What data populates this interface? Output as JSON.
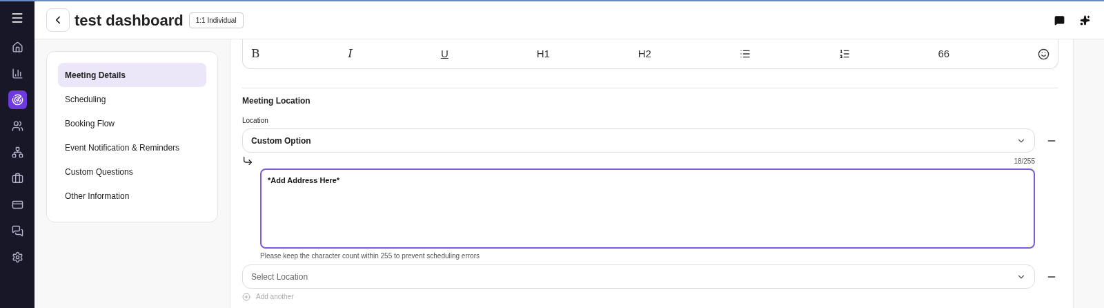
{
  "nav": [
    {
      "selected": false
    },
    {
      "selected": false
    },
    {
      "selected": true
    },
    {
      "selected": false
    },
    {
      "selected": false
    },
    {
      "selected": false
    },
    {
      "selected": false
    },
    {
      "selected": false
    },
    {
      "selected": false
    }
  ],
  "header": {
    "title": "test dashboard",
    "badge": "1:1 Individual"
  },
  "sections": [
    {
      "label": "Meeting Details",
      "selected": true
    },
    {
      "label": "Scheduling",
      "selected": false
    },
    {
      "label": "Booking Flow",
      "selected": false
    },
    {
      "label": "Event Notification & Reminders",
      "selected": false
    },
    {
      "label": "Custom Questions",
      "selected": false
    },
    {
      "label": "Other Information",
      "selected": false
    }
  ],
  "toolbar": [
    {
      "kind": "bold",
      "label": "B"
    },
    {
      "kind": "italic",
      "label": "I"
    },
    {
      "kind": "underline",
      "label": "U"
    },
    {
      "kind": "text",
      "label": "H1"
    },
    {
      "kind": "text",
      "label": "H2"
    },
    {
      "kind": "bullets"
    },
    {
      "kind": "numbers"
    },
    {
      "kind": "text",
      "label": "66"
    },
    {
      "kind": "emoji"
    }
  ],
  "meeting_location": {
    "heading": "Meeting Location",
    "field_label": "Location",
    "locations": [
      {
        "value": "Custom Option",
        "selected": true,
        "address": {
          "count": "18/255",
          "value": "*Add Address Here*",
          "hint": "Please keep the character count within 255 to prevent scheduling errors"
        }
      },
      {
        "value": "Select Location",
        "selected": false
      }
    ],
    "add_another": "Add another"
  }
}
